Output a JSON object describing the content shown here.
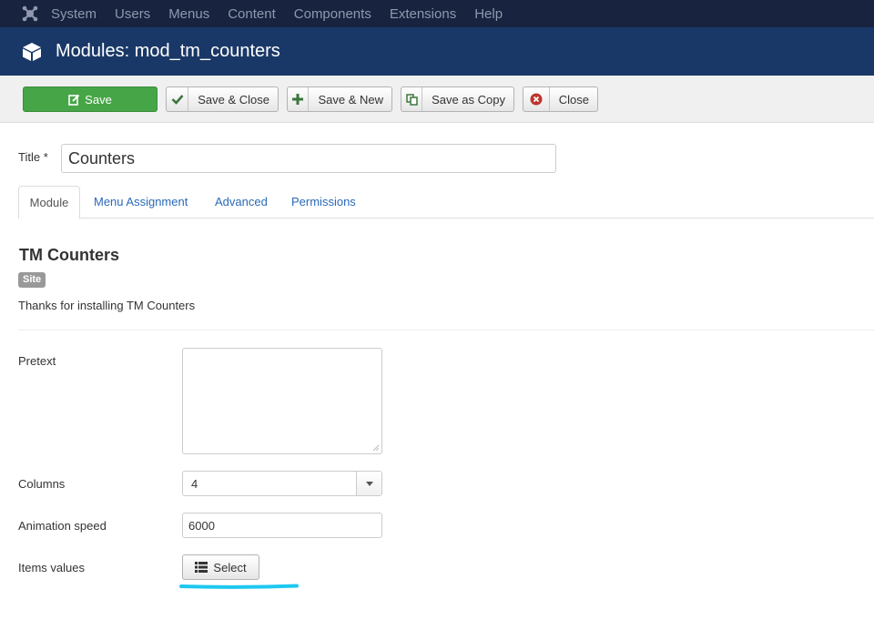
{
  "topnav": {
    "logo_icon": "joomla-logo-icon",
    "items": [
      "System",
      "Users",
      "Menus",
      "Content",
      "Components",
      "Extensions",
      "Help"
    ]
  },
  "header": {
    "icon": "cube-icon",
    "title": "Modules: mod_tm_counters"
  },
  "toolbar": {
    "save_label": "Save",
    "save_close_label": "Save & Close",
    "save_new_label": "Save & New",
    "save_copy_label": "Save as Copy",
    "close_label": "Close"
  },
  "form": {
    "title_label": "Title *",
    "title_value": "Counters",
    "tabs": [
      "Module",
      "Menu Assignment",
      "Advanced",
      "Permissions"
    ],
    "active_tab": "Module",
    "module_name": "TM Counters",
    "badge": "Site",
    "description": "Thanks for installing TM Counters",
    "fields": {
      "pretext_label": "Pretext",
      "pretext_value": "",
      "columns_label": "Columns",
      "columns_value": "4",
      "speed_label": "Animation speed",
      "speed_value": "6000",
      "items_label": "Items values",
      "items_button": "Select"
    }
  },
  "colors": {
    "topnav_bg": "#17233f",
    "header_bg": "#1a3867",
    "save_green": "#46a546",
    "link_blue": "#2a69b8",
    "highlight_cyan": "#1ec8f0"
  }
}
